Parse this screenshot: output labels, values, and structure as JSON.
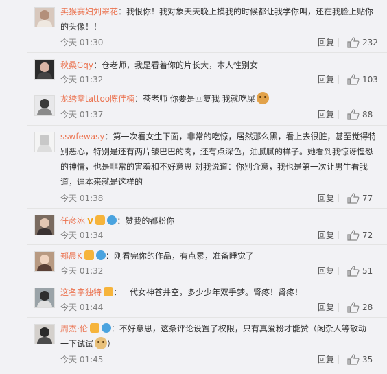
{
  "labels": {
    "reply": "回复"
  },
  "colors": {
    "username": "#eb7350",
    "text": "#333333",
    "meta": "#808080",
    "background": "#f2f2f5",
    "divider": "#e4e4e4"
  },
  "comments": [
    {
      "username": "卖猴赛妇刘翠花",
      "lines": [
        "：我恨你！我对象天天晚上摸我的时候都让我学你叫，还在我脸上贴你",
        "的头像！！"
      ],
      "time": "今天 01:30",
      "likes": "232"
    },
    {
      "username": "秋桑Gqy",
      "lines": [
        "：仓老师，我是看着你的片长大，本人性别女"
      ],
      "time": "今天 01:32",
      "likes": "103"
    },
    {
      "username": "龙绣堂tattoo陈佳楠",
      "lines": [
        "：苍老师 你要是回复我 我就吃屎"
      ],
      "time": "今天 01:37",
      "likes": "88",
      "emoji": "dog-emoji"
    },
    {
      "username": "sswfewasy",
      "lines": [
        "：第一次看女生下面，非常的吃惊，居然那么黑，看上去很脏，甚至觉得特",
        "别恶心，特别是还有两片皱巴巴的肉，还有点深色，油腻腻的样子。她看到我惊讶惶恐",
        "的神情，也是非常的害羞和不好意思 对我说道：你别介意，我也是第一次让男生看我",
        "道，逼本来就是这样的"
      ],
      "time": "今天 01:38",
      "likes": "77"
    },
    {
      "username": "任彦冰",
      "lines": [
        "：赞我的都粉你"
      ],
      "time": "今天 01:34",
      "likes": "72",
      "vip": "V"
    },
    {
      "username": "郑晨K",
      "lines": [
        "：刚看完你的作品，有点累，准备睡觉了"
      ],
      "time": "今天 01:32",
      "likes": "51"
    },
    {
      "username": "这名字独特",
      "lines": [
        "：一代女神苍井空，多少少年双手梦。肾疼！肾疼！"
      ],
      "time": "今天 01:44",
      "likes": "28"
    },
    {
      "username": "周杰·伦",
      "lines": [
        "：不好意思，这条评论设置了权限，只有真爱粉才能赞（闲杂人等散动",
        "一下试试"
      ],
      "tail": "）",
      "time": "今天 01:45",
      "likes": "35",
      "emoji": "doge-emoji"
    }
  ]
}
